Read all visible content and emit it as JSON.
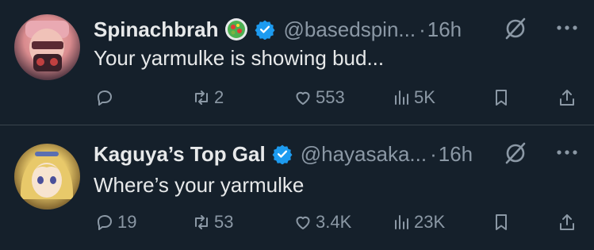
{
  "tweets": [
    {
      "name": "Spinachbrah",
      "handle": "@basedspin...",
      "separator": "·",
      "time": "16h",
      "text": "Your yarmulke is showing bud...",
      "replies": "",
      "retweets": "2",
      "likes": "553",
      "views": "5K",
      "has_emoji_badge": true
    },
    {
      "name": "Kaguya’s Top Gal",
      "handle": "@hayasaka...",
      "separator": "·",
      "time": "16h",
      "text": "Where’s your yarmulke",
      "replies": "19",
      "retweets": "53",
      "likes": "3.4K",
      "views": "23K",
      "has_emoji_badge": false
    }
  ],
  "colors": {
    "background": "#15202b",
    "text": "#e7e9ea",
    "muted": "#8b98a5",
    "verified": "#1d9bf0",
    "divider": "#38444d"
  },
  "icons": [
    "reply-icon",
    "retweet-icon",
    "like-icon",
    "views-icon",
    "bookmark-icon",
    "share-icon",
    "grok-icon",
    "more-icon",
    "verified-badge-icon"
  ]
}
